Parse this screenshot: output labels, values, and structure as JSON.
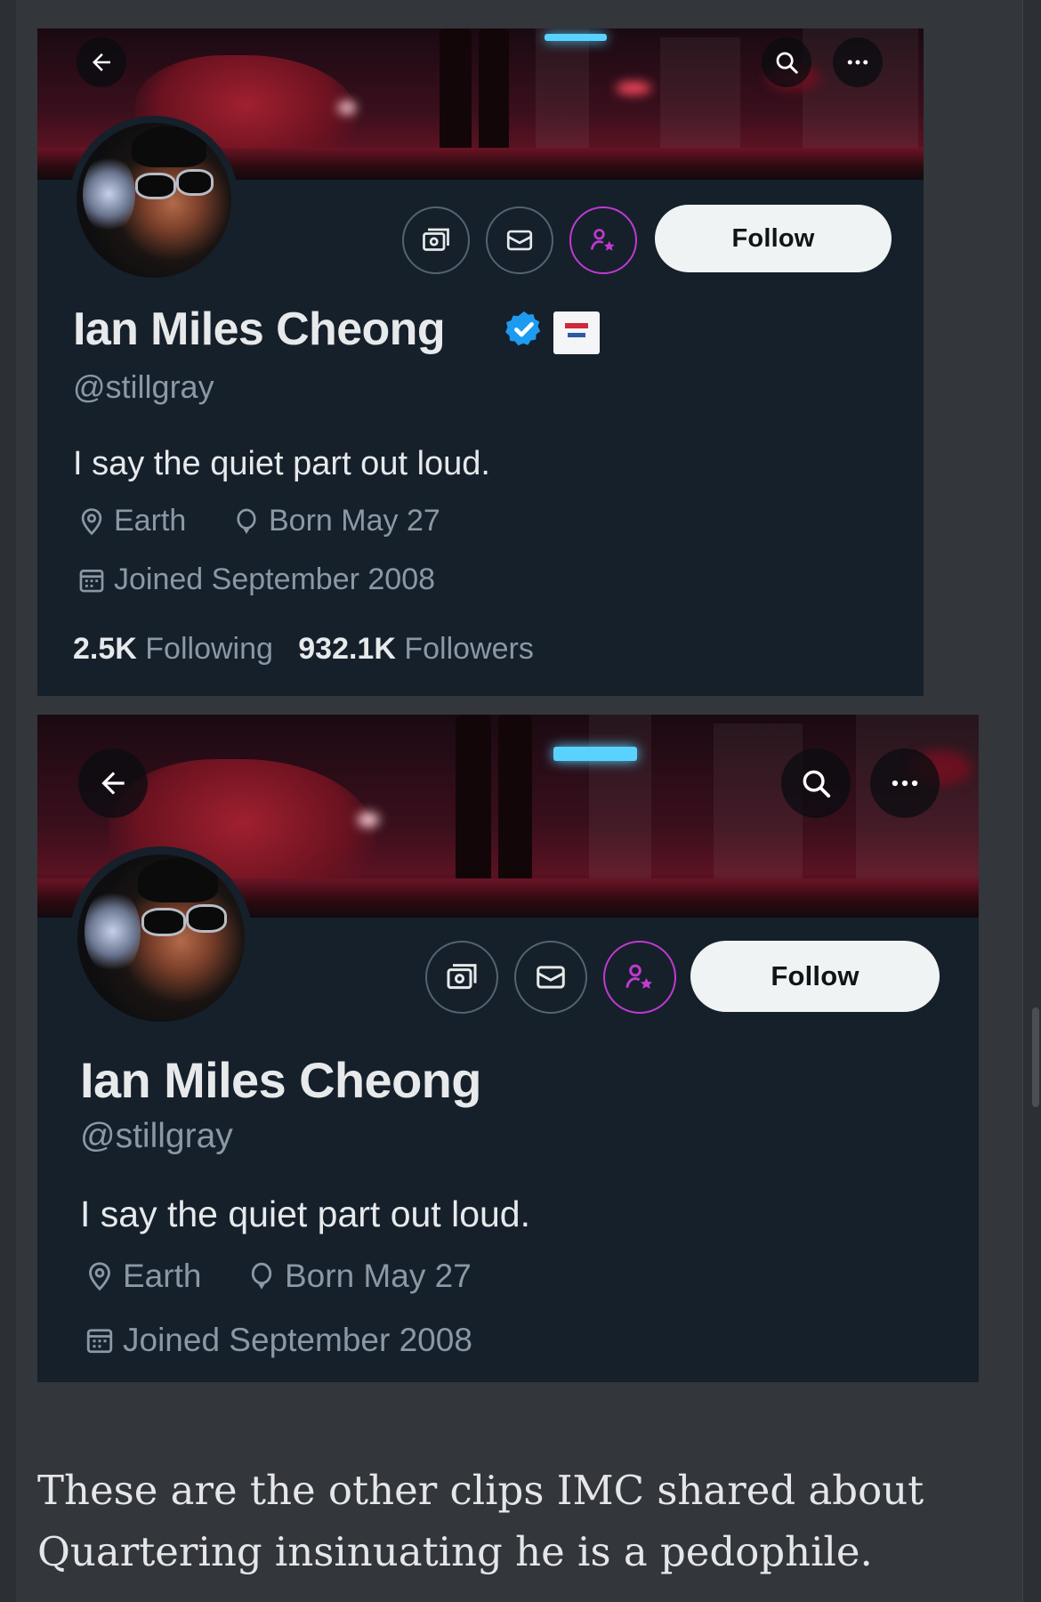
{
  "profiles": [
    {
      "name": "Ian Miles Cheong",
      "handle": "@stillgray",
      "bio": "I say the quiet part out loud.",
      "location": "Earth",
      "birthday": "Born May 27",
      "joined": "Joined September 2008",
      "following_count": "2.5K",
      "following_label": "Following",
      "followers_count": "932.1K",
      "followers_label": "Followers",
      "follow_label": "Follow",
      "verified": true,
      "affiliate_badge": true
    },
    {
      "name": "Ian Miles Cheong",
      "handle": "@stillgray",
      "bio": "I say the quiet part out loud.",
      "location": "Earth",
      "birthday": "Born May 27",
      "joined": "Joined September 2008",
      "follow_label": "Follow",
      "verified": false,
      "affiliate_badge": false
    }
  ],
  "caption": "These are the other clips IMC shared about Quartering insinuating he is a pedophile.",
  "colors": {
    "page_background": "#33363b",
    "card_background": "#15202b",
    "verified_blue": "#1d9bf0",
    "subscribe_purple": "#c03ad0",
    "secondary_text": "#8b98a5"
  },
  "icons": [
    "back-arrow-icon",
    "search-icon",
    "more-icon",
    "ticket-icon",
    "mail-icon",
    "subscribe-person-star-icon",
    "verified-badge-icon",
    "location-pin-icon",
    "balloon-icon",
    "calendar-icon"
  ]
}
